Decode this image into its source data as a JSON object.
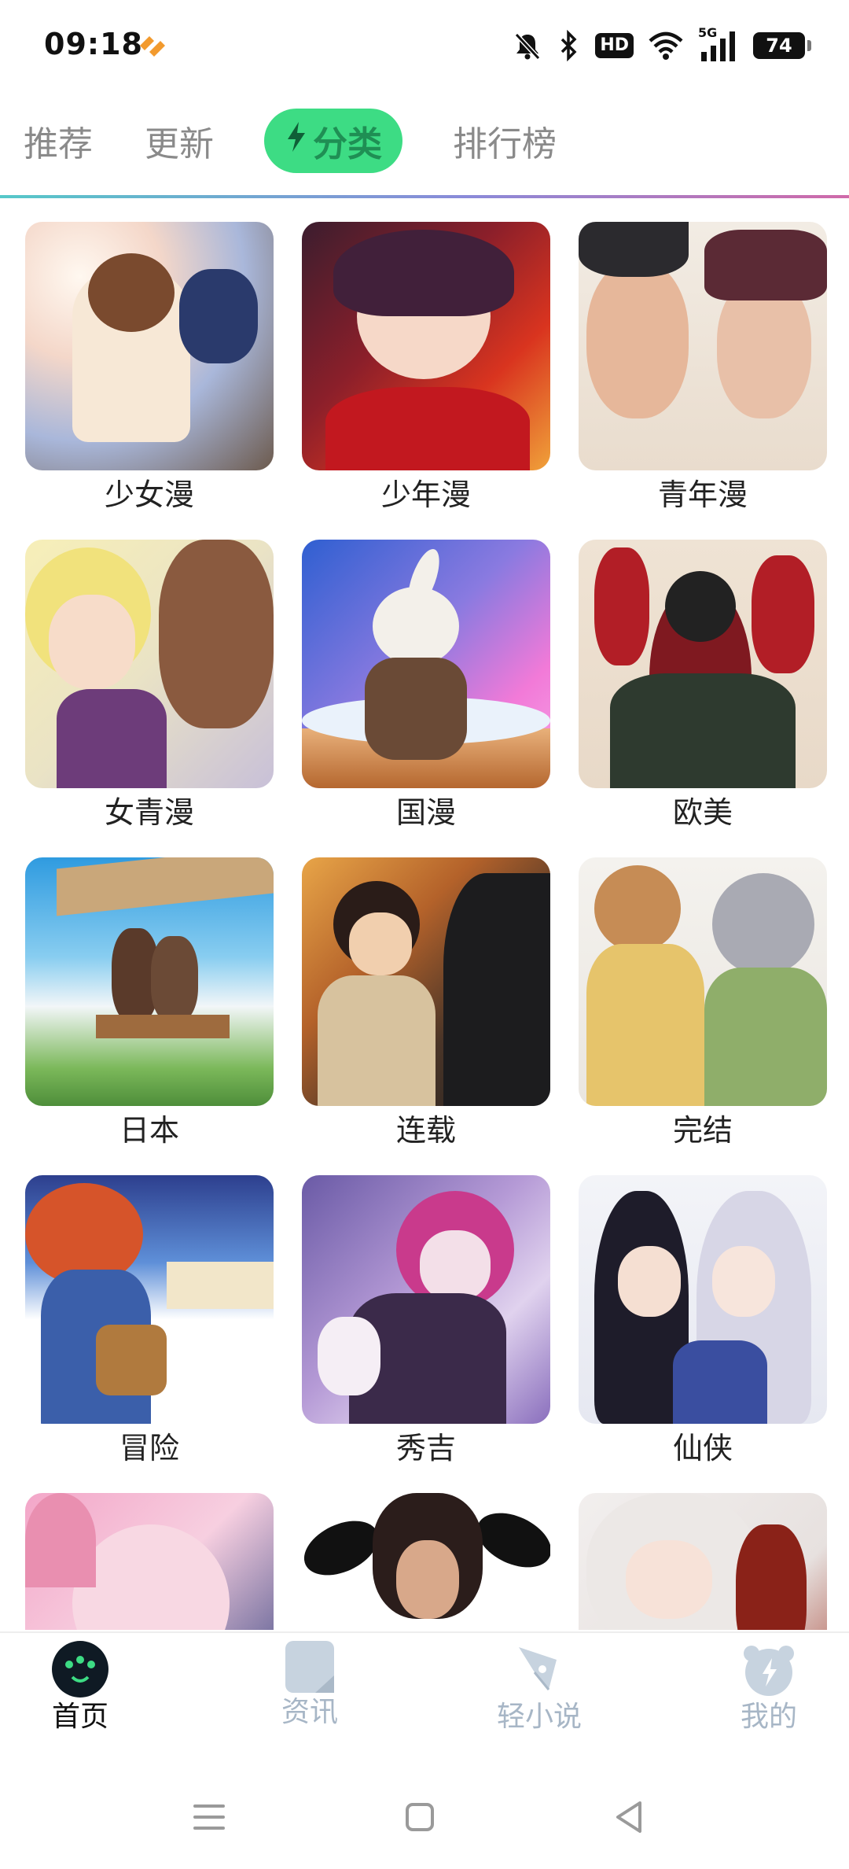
{
  "status_bar": {
    "time": "09:18",
    "hd": "HD",
    "network": "5G",
    "battery": "74",
    "icons": [
      "app-notification-icon",
      "mute-bell-icon",
      "bluetooth-icon",
      "hd-icon",
      "wifi-icon",
      "signal-5g-icon",
      "battery-icon"
    ]
  },
  "top_tabs": {
    "recommend": "推荐",
    "update": "更新",
    "category": "分类",
    "ranking": "排行榜",
    "active": "分类",
    "accent_color": "#3ddc84"
  },
  "categories": [
    {
      "label": "少女漫"
    },
    {
      "label": "少年漫"
    },
    {
      "label": "青年漫"
    },
    {
      "label": "女青漫"
    },
    {
      "label": "国漫"
    },
    {
      "label": "欧美"
    },
    {
      "label": "日本"
    },
    {
      "label": "连载"
    },
    {
      "label": "完结"
    },
    {
      "label": "冒险"
    },
    {
      "label": "秀吉"
    },
    {
      "label": "仙侠"
    },
    {
      "label": ""
    },
    {
      "label": ""
    },
    {
      "label": ""
    }
  ],
  "bottom_nav": {
    "home": "首页",
    "news": "资讯",
    "novel": "轻小说",
    "mine": "我的",
    "active": "首页"
  }
}
